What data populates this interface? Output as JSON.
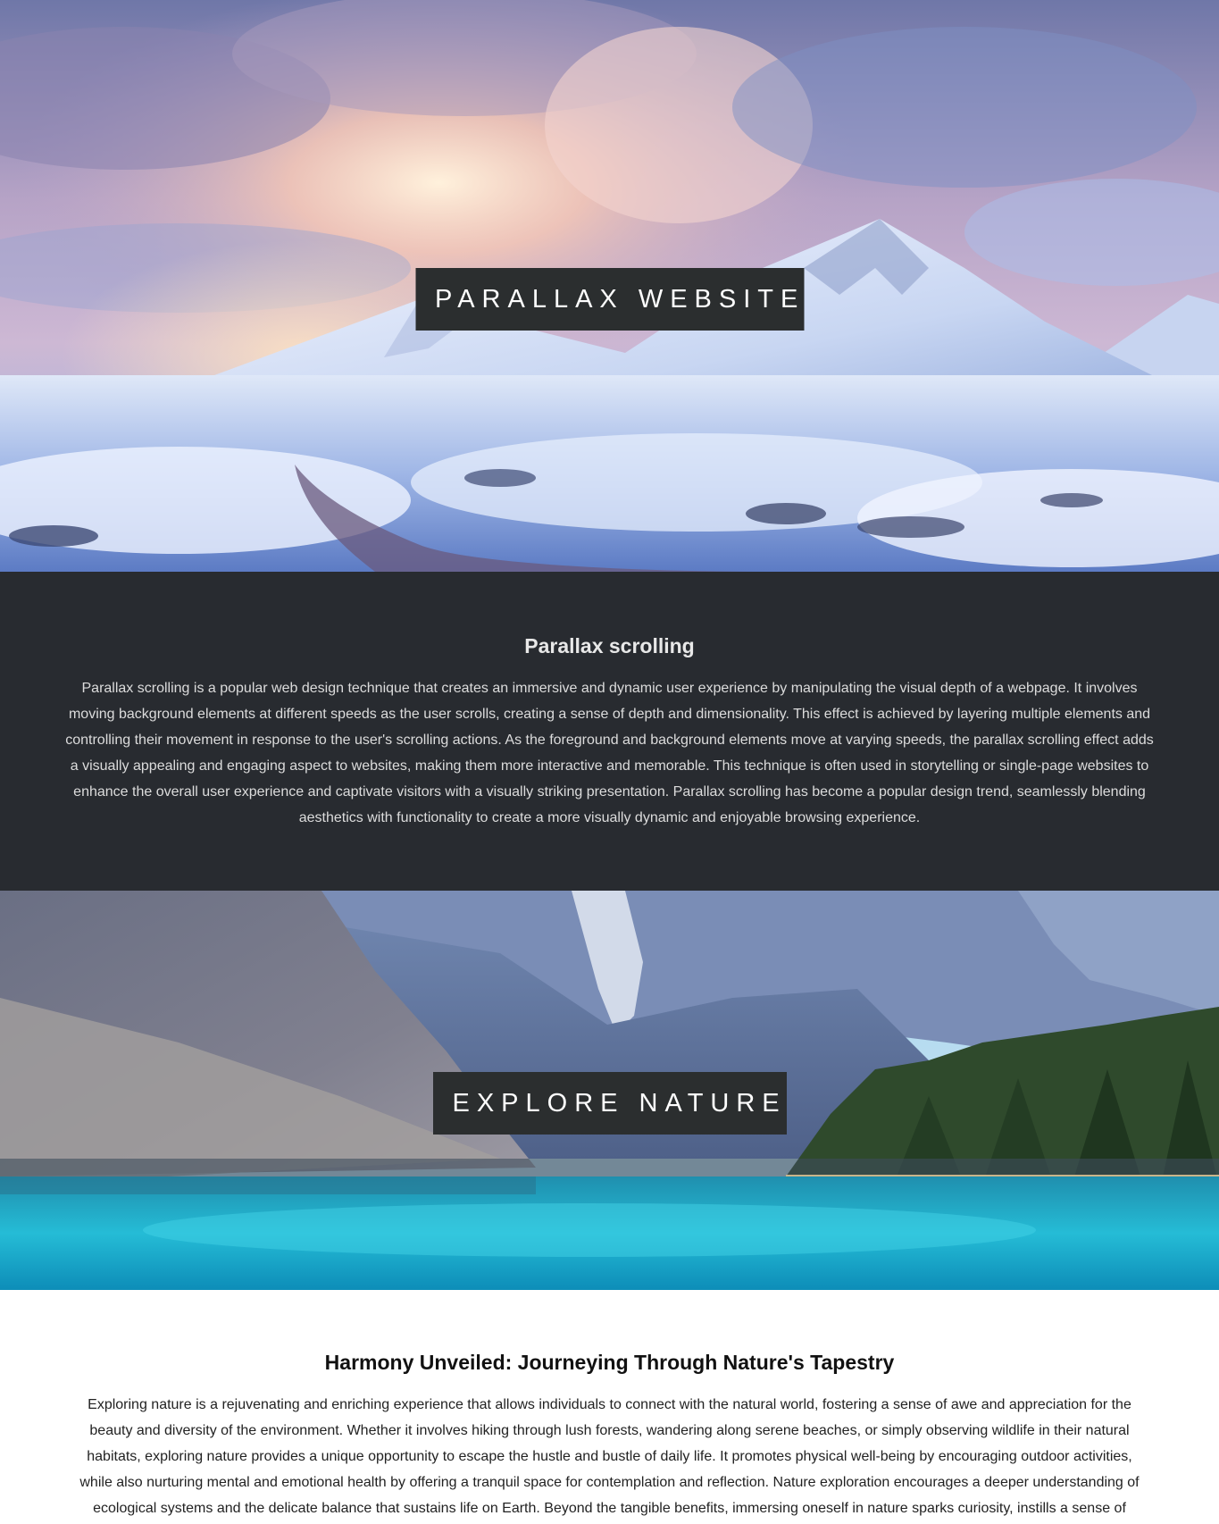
{
  "hero_top": {
    "title": "PARALLAX WEBSITE"
  },
  "section_parallax": {
    "heading": "Parallax scrolling",
    "body": "Parallax scrolling is a popular web design technique that creates an immersive and dynamic user experience by manipulating the visual depth of a webpage. It involves moving background elements at different speeds as the user scrolls, creating a sense of depth and dimensionality. This effect is achieved by layering multiple elements and controlling their movement in response to the user's scrolling actions. As the foreground and background elements move at varying speeds, the parallax scrolling effect adds a visually appealing and engaging aspect to websites, making them more interactive and memorable. This technique is often used in storytelling or single-page websites to enhance the overall user experience and captivate visitors with a visually striking presentation. Parallax scrolling has become a popular design trend, seamlessly blending aesthetics with functionality to create a more visually dynamic and enjoyable browsing experience."
  },
  "hero_bottom": {
    "title": "EXPLORE NATURE"
  },
  "section_nature": {
    "heading": "Harmony Unveiled: Journeying Through Nature's Tapestry",
    "body": "Exploring nature is a rejuvenating and enriching experience that allows individuals to connect with the natural world, fostering a sense of awe and appreciation for the beauty and diversity of the environment. Whether it involves hiking through lush forests, wandering along serene beaches, or simply observing wildlife in their natural habitats, exploring nature provides a unique opportunity to escape the hustle and bustle of daily life. It promotes physical well-being by encouraging outdoor activities, while also nurturing mental and emotional health by offering a tranquil space for contemplation and reflection. Nature exploration encourages a deeper understanding of ecological systems and the delicate balance that sustains life on Earth. Beyond the tangible benefits, immersing oneself in nature sparks curiosity, instills a sense of"
  },
  "colors": {
    "title_box": "#2b2e2f",
    "dark_section": "#282b30",
    "light_section": "#ffffff"
  }
}
